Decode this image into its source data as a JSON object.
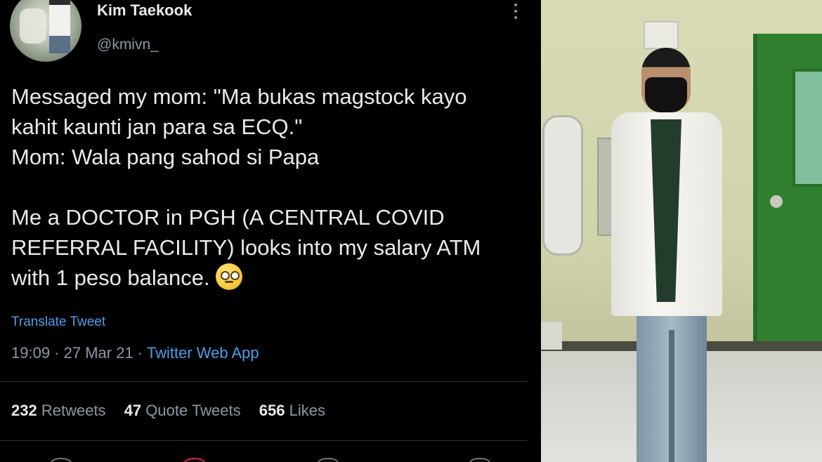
{
  "tweet": {
    "author_name": "Kim Taekook",
    "author_handle": "@kmivn_",
    "text_lines": [
      "Messaged my mom: \"Ma bukas magstock kayo",
      "kahit kaunti jan para sa ECQ.\"",
      "Mom: Wala pang sahod si Papa"
    ],
    "text_lines_2": [
      "Me a DOCTOR in PGH (A CENTRAL COVID",
      "REFERRAL FACILITY) looks into my salary ATM",
      "with 1 peso balance."
    ],
    "emoji": "face-with-rolling-eyes",
    "translate_label": "Translate Tweet",
    "time": "19:09",
    "date": "27 Mar 21",
    "source": "Twitter Web App",
    "retweets_count": "232",
    "retweets_label": "Retweets",
    "quotes_count": "47",
    "quotes_label": "Quote Tweets",
    "likes_count": "656",
    "likes_label": "Likes"
  },
  "colors": {
    "background": "#000000",
    "text": "#e8eaed",
    "muted": "#8b98a5",
    "link": "#4a9fe8"
  }
}
